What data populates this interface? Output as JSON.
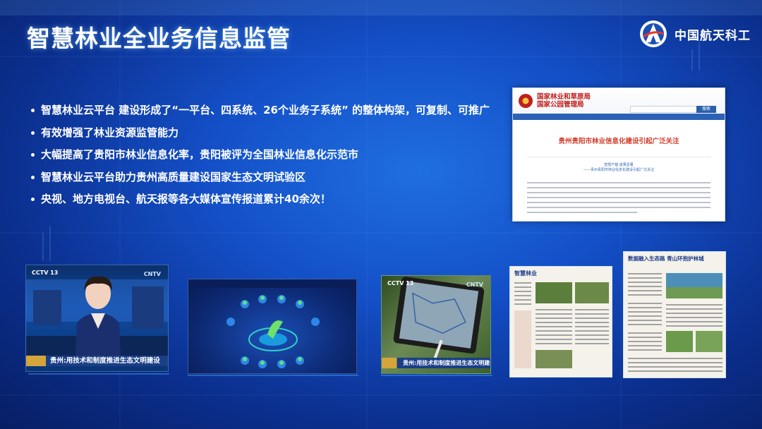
{
  "slide": {
    "title": "智慧林业全业务信息监管",
    "logo_text": "中国航天科工",
    "colors": {
      "background": "#1450c8",
      "title": "#ffffff",
      "accent": "#5fc0ff"
    }
  },
  "bullets": [
    "智慧林业云平台 建设形成了“一平台、四系统、26个业务子系统” 的整体构架，可复制、可推广",
    "有效增强了林业资源监管能力",
    "大幅提高了贵阳市林业信息化率，贵阳被评为全国林业信息化示范市",
    "智慧林业云平台助力贵州高质量建设国家生态文明试验区",
    "央视、地方电视台、航天报等各大媒体宣传报道累计40余次！"
  ],
  "website": {
    "org_line1": "国家林业和草原局",
    "org_line2": "国家公园管理局",
    "search_button": "搜索",
    "headline": "贵州贵阳市林业信息化建设引起广泛关注",
    "subheading_1": "智慧产植 成果显著",
    "subheading_2": "——贵州贵阳市林业信息化建设引起广泛关注"
  },
  "media": {
    "cctv_caption_1": "贵州:用技术和制度推进生态文明建设",
    "cctv_caption_2": "贵州:用技术和制度推进生态文明建设",
    "cctv_logo": "CCTV 13",
    "cctv_logo_right": "CNTV",
    "paper1_title": "智慧林业",
    "paper2_title": "数据融入生态路 青山环抱护林城"
  }
}
